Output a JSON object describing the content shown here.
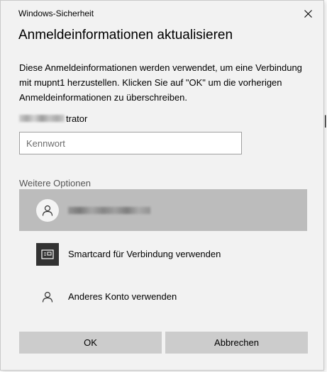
{
  "window": {
    "title": "Windows-Sicherheit",
    "close_glyph": "✕"
  },
  "dialog": {
    "heading": "Anmeldeinformationen aktualisieren",
    "description": "Diese Anmeldeinformationen werden verwendet, um eine Verbindung mit mupnt1 herzustellen. Klicken Sie auf \"OK\" um die vorherigen Anmeldeinformationen zu überschreiben.",
    "username_suffix": "trator",
    "password": {
      "value": "",
      "placeholder": "Kennwort"
    },
    "more_options_label": "Weitere Optionen",
    "options": [
      {
        "type": "account",
        "icon": "user-icon",
        "label_redacted": true,
        "selected": true
      },
      {
        "type": "smartcard",
        "icon": "smartcard-icon",
        "label": "Smartcard für Verbindung verwenden",
        "selected": false
      },
      {
        "type": "other-account",
        "icon": "user-icon",
        "label": "Anderes Konto verwenden",
        "selected": false
      }
    ],
    "buttons": {
      "ok": "OK",
      "cancel": "Abbrechen"
    }
  },
  "colors": {
    "dialog_bg": "#f2f2f2",
    "selected_bg": "#bcbcbc",
    "button_bg": "#cccccc",
    "smartcard_icon_bg": "#333333"
  }
}
